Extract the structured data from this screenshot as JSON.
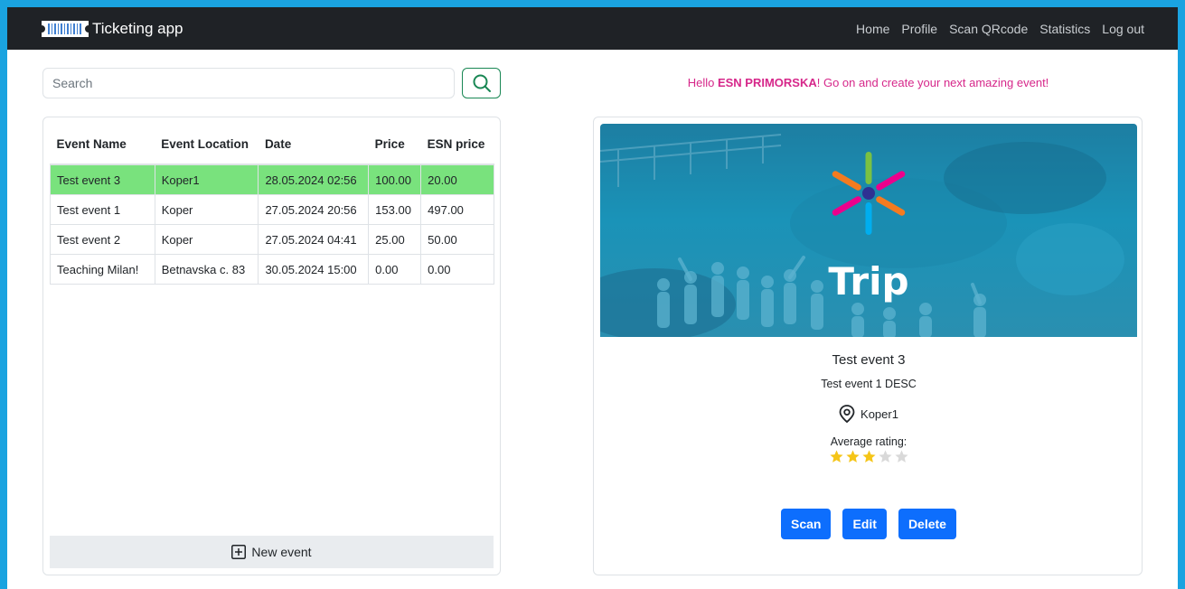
{
  "navbar": {
    "brand": "Ticketing app",
    "links": [
      "Home",
      "Profile",
      "Scan QRcode",
      "Statistics",
      "Log out"
    ]
  },
  "search": {
    "placeholder": "Search",
    "value": ""
  },
  "table": {
    "headers": [
      "Event Name",
      "Event Location",
      "Date",
      "Price",
      "ESN price"
    ],
    "rows": [
      {
        "name": "Test event 3",
        "location": "Koper1",
        "date": "28.05.2024 02:56",
        "price": "100.00",
        "esn_price": "20.00"
      },
      {
        "name": "Test event 1",
        "location": "Koper",
        "date": "27.05.2024 20:56",
        "price": "153.00",
        "esn_price": "497.00"
      },
      {
        "name": "Test event 2",
        "location": "Koper",
        "date": "27.05.2024 04:41",
        "price": "25.00",
        "esn_price": "50.00"
      },
      {
        "name": "Teaching Milan!",
        "location": "Betnavska c. 83",
        "date": "30.05.2024 15:00",
        "price": "0.00",
        "esn_price": "0.00"
      }
    ],
    "selected_row": 0,
    "new_event_label": "New event"
  },
  "greeting": {
    "prefix": "Hello ",
    "name": "ESN PRIMORSKA",
    "suffix": "! Go on and create your next amazing event!"
  },
  "detail": {
    "banner_text": "Trip",
    "title": "Test event 3",
    "description": "Test event 1 DESC",
    "location": "Koper1",
    "rating_label": "Average rating:",
    "rating": 3,
    "rating_max": 5,
    "buttons": {
      "scan": "Scan",
      "edit": "Edit",
      "delete": "Delete"
    }
  },
  "colors": {
    "navbar_bg": "#1f2226",
    "selected_row": "#79e27d",
    "greeting": "#d6278a",
    "primary_button": "#0d6efd",
    "search_button_border": "#198754",
    "star_filled": "#f5c518",
    "star_empty": "#d9d9d9"
  },
  "icons": {
    "brand": "barcode-ticket-icon",
    "search": "search-icon",
    "new_event": "plus-square-icon",
    "location": "map-pin-icon",
    "star": "star-icon"
  }
}
